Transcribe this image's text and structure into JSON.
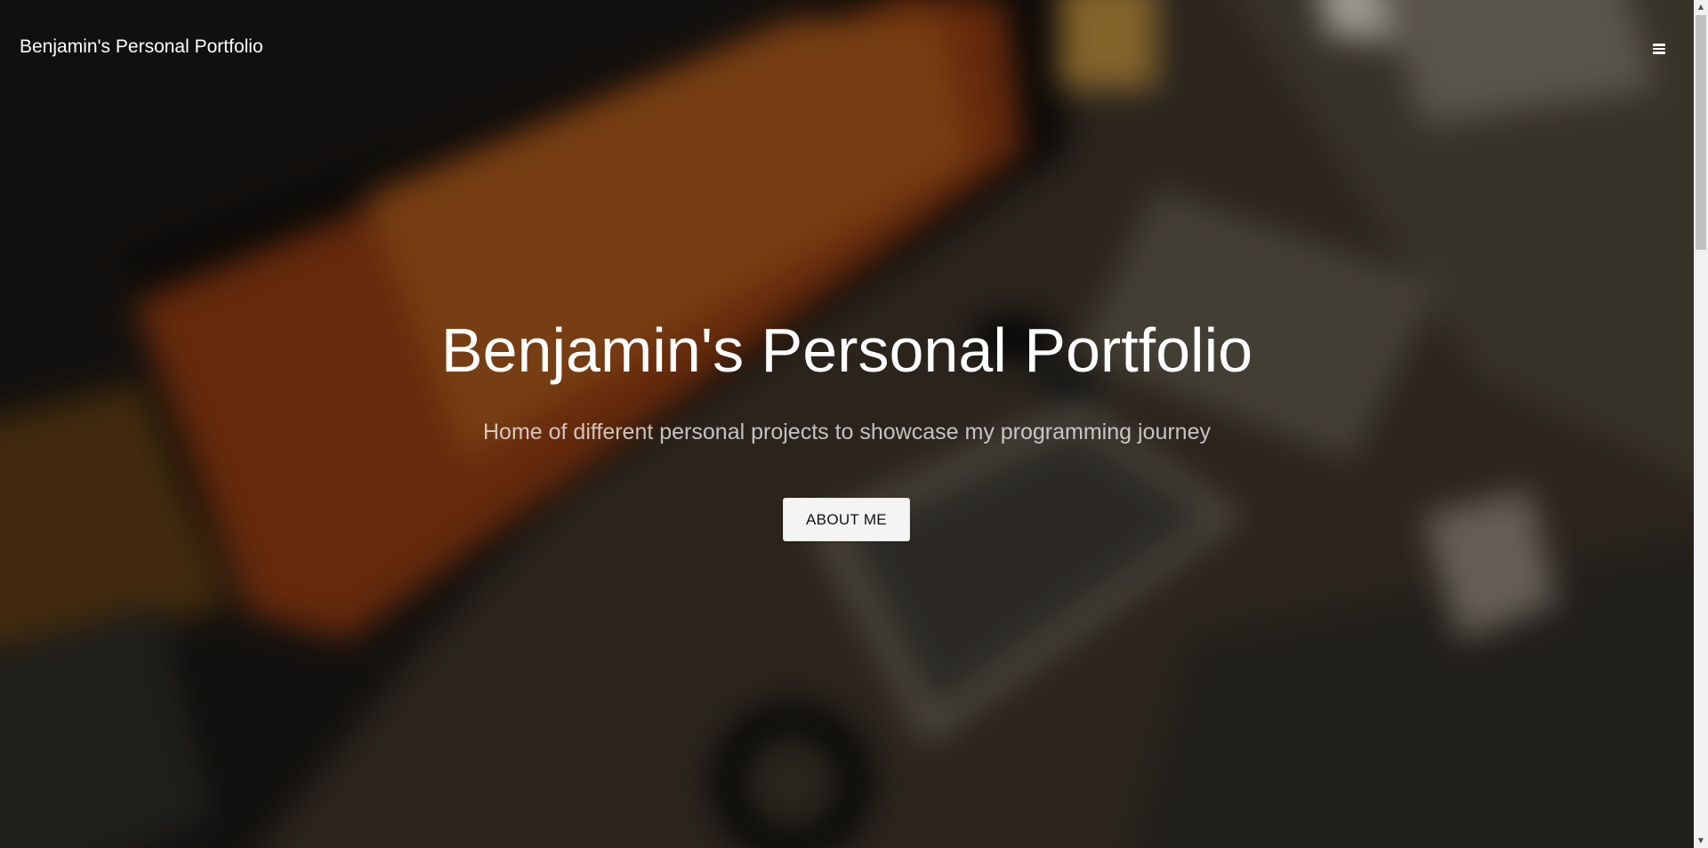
{
  "navbar": {
    "brand": "Benjamin's Personal Portfolio",
    "menu_icon": "bars-icon"
  },
  "hero": {
    "title": "Benjamin's Personal Portfolio",
    "subtitle": "Home of different personal projects to showcase my programming journey",
    "button_label": "ABOUT ME",
    "background_image": "blurred desk with monitor and keyboard"
  },
  "scrollbar": {
    "up_icon": "scroll-up-arrow-icon",
    "down_icon": "scroll-down-arrow-icon"
  },
  "colors": {
    "text_primary": "#ffffff",
    "button_background": "#f4f4f4",
    "button_text": "#111111"
  }
}
